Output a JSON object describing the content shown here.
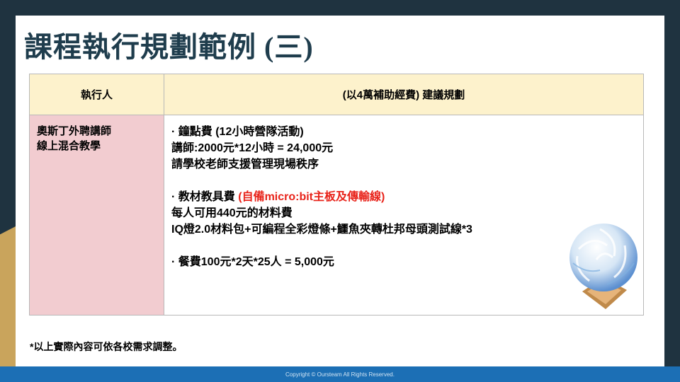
{
  "title": "課程執行規劃範例 (三)",
  "table": {
    "header_left": "執行人",
    "header_right": "(以4萬補助經費) 建議規劃",
    "left_lines": [
      "奧斯丁外聘講師",
      "線上混合教學"
    ],
    "item1": {
      "heading": "· 鐘點費 (12小時營隊活動)",
      "line1": "講師:2000元*12小時 = 24,000元",
      "line2": "請學校老師支援管理現場秩序"
    },
    "item2": {
      "heading_prefix": "· 教材教具費 ",
      "heading_red": "(自備micro:bit主板及傳輸線)",
      "line1": "每人可用440元的材料費",
      "line2": "IQ燈2.0材料包+可編程全彩燈條+鱷魚夾轉杜邦母頭測試線*3"
    },
    "item3": {
      "heading": "· 餐費100元*2天*25人 = 5,000元"
    }
  },
  "note": "*以上實際內容可依各校需求調整。",
  "footer": "Copyright © Oursteam All Rights Reserved.",
  "colors": {
    "header_bg": "#fdf2cc",
    "left_cell_bg": "#f2ccd0",
    "accent_red": "#e8231a",
    "title": "#1f3d4d",
    "footer_bg": "#1c6fb5"
  },
  "icons": {
    "lamp": "iq-lamp-image"
  }
}
